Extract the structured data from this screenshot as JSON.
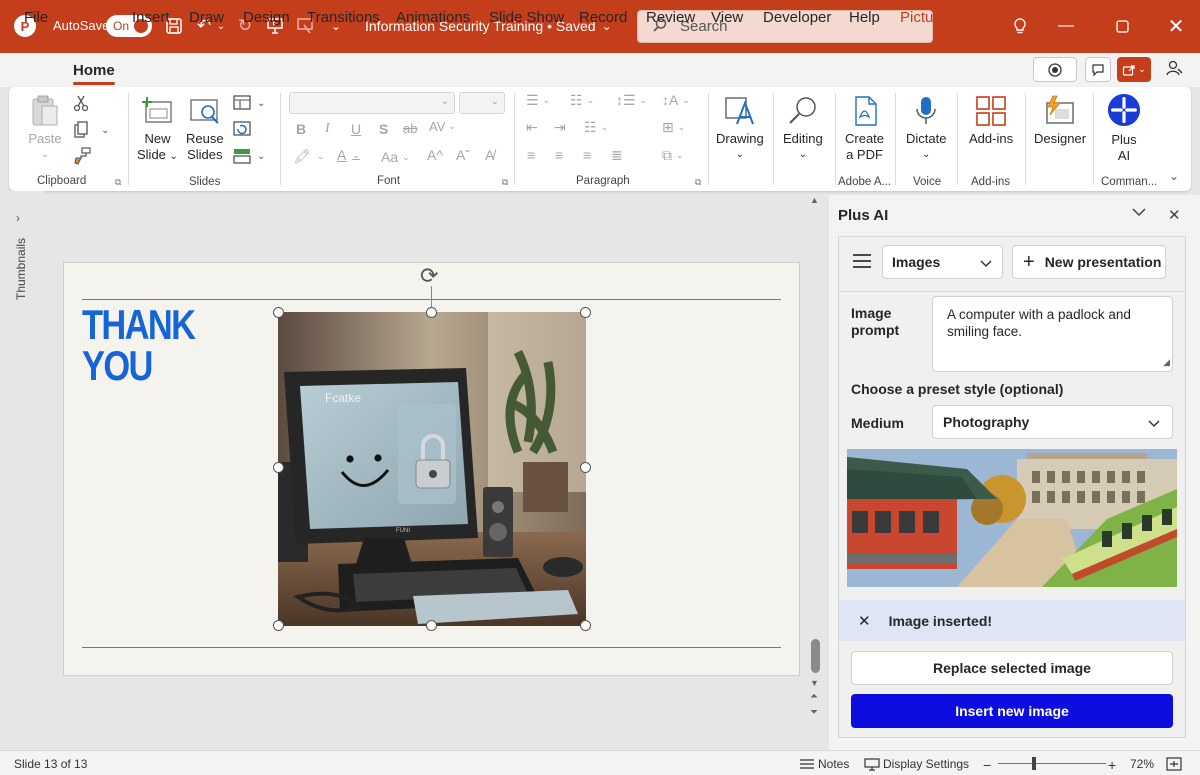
{
  "titlebar": {
    "autosave_label": "AutoSave",
    "autosave_state": "On",
    "document_title": "Information Security Training • Saved",
    "search_placeholder": "Search"
  },
  "menu": {
    "items": [
      "File",
      "Home",
      "Insert",
      "Draw",
      "Design",
      "Transitions",
      "Animations",
      "Slide Show",
      "Record",
      "Review",
      "View",
      "Developer",
      "Help",
      "Picture Format"
    ],
    "active": "Home"
  },
  "ribbon": {
    "clipboard": {
      "paste": "Paste",
      "group": "Clipboard"
    },
    "slides": {
      "new_slide": "New",
      "new_slide_2": "Slide",
      "reuse": "Reuse",
      "reuse_2": "Slides",
      "group": "Slides"
    },
    "font": {
      "group": "Font"
    },
    "paragraph": {
      "group": "Paragraph"
    },
    "drawing": "Drawing",
    "editing": "Editing",
    "create_pdf": "Create",
    "create_pdf_2": "a PDF",
    "adobe_group": "Adobe A...",
    "dictate": "Dictate",
    "voice_group": "Voice",
    "addins": "Add-ins",
    "addins_group": "Add-ins",
    "designer": "Designer",
    "plus_ai": "Plus",
    "plus_ai_2": "AI",
    "commands_group": "Comman..."
  },
  "thumbnails_label": "Thumbnails",
  "slide": {
    "title_line1": "THANK",
    "title_line2": "YOU",
    "screen_text": "Fcatke",
    "monitor_brand": "FUNI"
  },
  "pane": {
    "title": "Plus AI",
    "mode_select": "Images",
    "new_presentation": "New presentation",
    "image_prompt_label_1": "Image",
    "image_prompt_label_2": "prompt",
    "image_prompt_value": "A computer with a padlock and smiling face.",
    "preset_label": "Choose a preset style (optional)",
    "medium_label": "Medium",
    "medium_value": "Photography",
    "notice": "Image inserted!",
    "replace_button": "Replace selected image",
    "insert_button": "Insert new image"
  },
  "status": {
    "slide_count": "Slide 13 of 13",
    "notes": "Notes",
    "display_settings": "Display Settings",
    "zoom": "72%"
  },
  "colors": {
    "accent": "#c43e1c",
    "slide_title": "#1565d8",
    "insert_button": "#0d0de0"
  }
}
